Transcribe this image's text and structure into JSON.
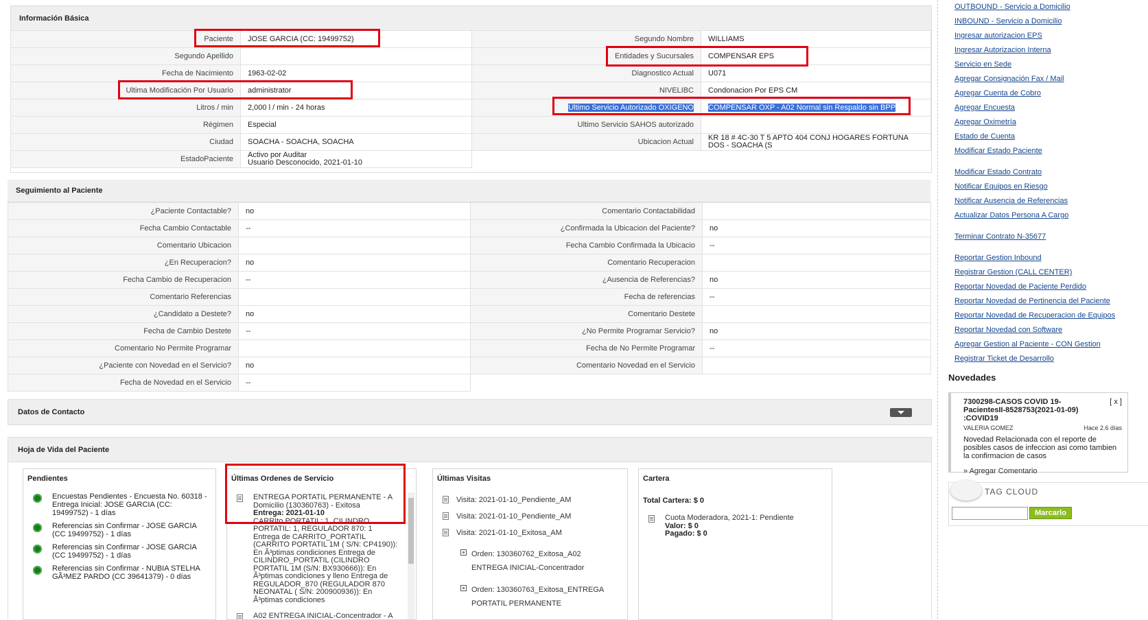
{
  "basic": {
    "title": "Información Básica",
    "left": [
      {
        "label": "Paciente",
        "value": "JOSE GARCIA (CC: 19499752)"
      },
      {
        "label": "Segundo Apellido",
        "value": ""
      },
      {
        "label": "Fecha de Nacimiento",
        "value": "1963-02-02"
      },
      {
        "label": "Ultima Modificación Por Usuario",
        "value": "administrator"
      },
      {
        "label": "Litros / min",
        "value": "2,000 l / min - 24 horas"
      },
      {
        "label": "Régimen",
        "value": "Especial"
      },
      {
        "label": "Ciudad",
        "value": "SOACHA - SOACHA, SOACHA"
      },
      {
        "label": "EstadoPaciente",
        "value": "Activo por Auditar\nUsuario Desconocido, 2021-01-10"
      }
    ],
    "right": [
      {
        "label": "Segundo Nombre",
        "value": "WILLIAMS"
      },
      {
        "label": "Entidades y Sucursales",
        "value": "COMPENSAR EPS"
      },
      {
        "label": "Diagnostico Actual",
        "value": "U071"
      },
      {
        "label": "NIVELIBC",
        "value": "Condonacion Por EPS CM"
      },
      {
        "label": "Ultimo Servicio Autorizado OXIGENO",
        "value": "COMPENSAR OXP - A02 Normal sin Respaldo sin BPP"
      },
      {
        "label": "Ultimo Servicio SAHOS autorizado",
        "value": ""
      },
      {
        "label": "Ubicacion Actual",
        "value": "KR 18 # 4C-30 T 5 APTO 404 CONJ HOGARES FORTUNA DOS - SOACHA (S"
      }
    ]
  },
  "seguimiento": {
    "title": "Seguimiento al Paciente",
    "left": [
      {
        "label": "¿Paciente Contactable?",
        "value": "no"
      },
      {
        "label": "Fecha Cambio Contactable",
        "value": "--"
      },
      {
        "label": "Comentario Ubicacion",
        "value": ""
      },
      {
        "label": "¿En Recuperacion?",
        "value": "no"
      },
      {
        "label": "Fecha Cambio de Recuperacion",
        "value": "--"
      },
      {
        "label": "Comentario Referencias",
        "value": ""
      },
      {
        "label": "¿Candidato a Destete?",
        "value": "no"
      },
      {
        "label": "Fecha de Cambio Destete",
        "value": "--"
      },
      {
        "label": "Comentario No Permite Programar",
        "value": ""
      },
      {
        "label": "¿Paciente con Novedad en el Servicio?",
        "value": "no"
      },
      {
        "label": "Fecha de Novedad en el Servicio",
        "value": "--"
      }
    ],
    "right": [
      {
        "label": "Comentario Contactabilidad",
        "value": ""
      },
      {
        "label": "¿Confirmada la Ubicacion del Paciente?",
        "value": "no"
      },
      {
        "label": "Fecha Cambio Confirmada la Ubicacio",
        "value": "--"
      },
      {
        "label": "Comentario Recuperacion",
        "value": ""
      },
      {
        "label": "¿Ausencia de Referencias?",
        "value": "no"
      },
      {
        "label": "Fecha de referencias",
        "value": "--"
      },
      {
        "label": "Comentario Destete",
        "value": ""
      },
      {
        "label": "¿No Permite Programar Servicio?",
        "value": "no"
      },
      {
        "label": "Fecha de No Permite Programar",
        "value": "--"
      },
      {
        "label": "Comentario Novedad en el Servicio",
        "value": ""
      }
    ]
  },
  "contacto": {
    "title": "Datos de Contacto"
  },
  "hoja": {
    "title": "Hoja de Vida del Paciente",
    "pendientes": {
      "title": "Pendientes",
      "items": [
        "Encuestas Pendientes - Encuesta No. 60318 - Entrega Inicial: JOSE GARCIA (CC: 19499752) - 1 días",
        "Referencias sin Confirmar - JOSE GARCIA (CC 19499752) - 1 días",
        "Referencias sin Confirmar - JOSE GARCIA (CC 19499752) - 1 días",
        "Referencias sin Confirmar - NUBIA STELHA GÃ³MEZ PARDO (CC 39641379) - 0 días"
      ]
    },
    "ordenes": {
      "title": "Últimas Ordenes de Servicio",
      "item1_head": "ENTREGA PORTATIL PERMANENTE - A Domicilio (130360763) - Exitosa",
      "item1_bold": "Entrega: 2021-01-10",
      "item1_body": "CARRIto PORTATIL: 1, CILINDRO PORTATIL: 1, REGULADOR 870: 1 Entrega de CARRITO_PORTATIL (CARRITO PORTATIL 1M ( S/N: CP4190)): En Ã³ptimas condiciones Entrega de CILINDRO_PORTATIL (CILINDRO PORTATIL 1M (S/N: BX930666)): En Ã³ptimas condiciones y lleno Entrega de REGULADOR_870 (REGULADOR 870 NEONATAL ( S/N: 200900936)): En Ã³ptimas condiciones",
      "item2_head": "A02 ENTREGA INICIAL-Concentrador - A"
    },
    "visitas": {
      "title": "Últimas Visitas",
      "items": [
        "Visita: 2021-01-10_Pendiente_AM",
        "Visita: 2021-01-10_Pendiente_AM",
        "Visita: 2021-01-10_Exitosa_AM"
      ],
      "orders": [
        [
          "Orden: 130360762_Exitosa_A02",
          "ENTREGA INICIAL-Concentrador"
        ],
        [
          "Orden: 130360763_Exitosa_ENTREGA",
          "PORTATIL PERMANENTE"
        ]
      ]
    },
    "cartera": {
      "title": "Cartera",
      "total": "Total Cartera: $ 0",
      "item": "Cuota Moderadora, 2021-1: Pendiente",
      "valor": "Valor: $ 0",
      "pagado": "Pagado: $ 0"
    }
  },
  "sidebar": {
    "links1": [
      "OUTBOUND - Servicio a Domicilio",
      "INBOUND - Servicio a Domicilio",
      "Ingresar autorizacion EPS",
      "Ingresar Autorizacion Interna",
      "Servicio en Sede",
      "Agregar Consignación Fax / Mail",
      "Agregar Cuenta de Cobro",
      "Agregar Encuesta",
      "Agregar Oximetría",
      "Estado de Cuenta",
      "Modificar Estado Paciente"
    ],
    "links2": [
      "Modificar Estado Contrato",
      "Notificar Equipos en Riesgo",
      "Notificar Ausencia de Referencias",
      "Actualizar Datos Persona A Cargo"
    ],
    "links3": [
      "Terminar Contrato N-35677"
    ],
    "links4": [
      "Reportar Gestion Inbound",
      "Registrar Gestion (CALL CENTER)",
      "Reportar Novedad de Paciente Perdido",
      "Reportar Novedad de Pertinencia del Paciente",
      "Reportar Novedad de Recuperacion de Equipos",
      "Reportar Novedad con Software",
      "Agregar Gestion al Paciente - CON Gestion",
      "Registrar Ticket de Desarrollo"
    ],
    "novedades": {
      "title": "Novedades",
      "note_title": "7300298-CASOS COVID 19-PacientesII-8528753(2021-01-09) :COVID19",
      "close": "[ x ]",
      "user": "VALERIA GOMEZ",
      "ago": "Hace 2.6 días",
      "body": "Novedad Relacionada con el reporte de posibles casos de infeccion asi como tambien la confirmacion de casos",
      "add_comment": "» Agregar Comentario"
    },
    "tagcloud": {
      "title": "TAG CLOUD",
      "button": "Marcarlo",
      "input_value": ""
    }
  }
}
